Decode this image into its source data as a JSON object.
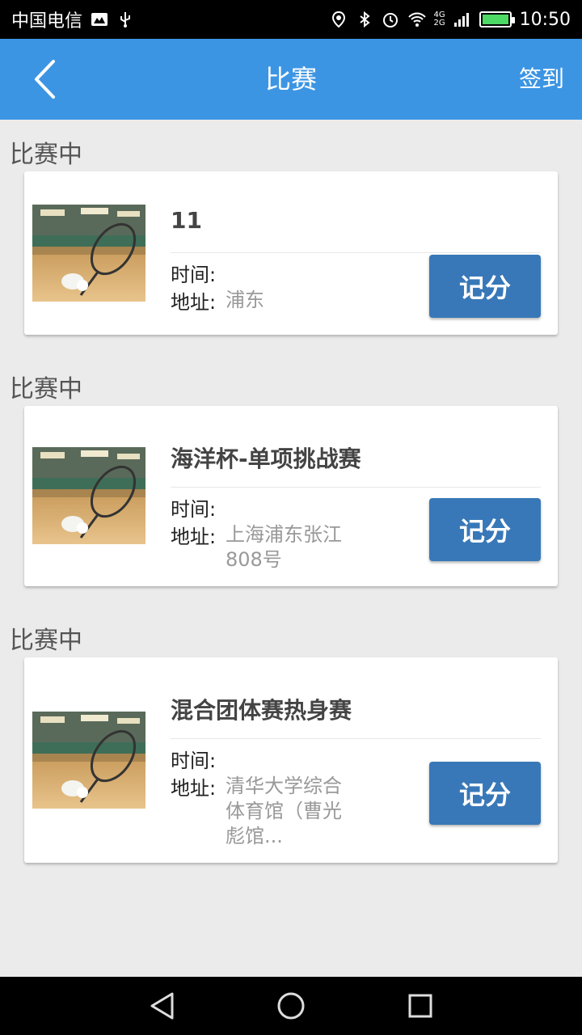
{
  "status_bar": {
    "carrier": "中国电信",
    "signal_top": "4G",
    "signal_bottom": "2G",
    "time": "10:50",
    "battery_level": 1.0
  },
  "header": {
    "title": "比赛",
    "signin_label": "签到"
  },
  "matches": [
    {
      "section_label": "比赛中",
      "title": "11",
      "time_label": "时间:",
      "time_value": "",
      "address_label": "地址:",
      "address_value": "浦东",
      "button_label": "记分"
    },
    {
      "section_label": "比赛中",
      "title": "海洋杯-单项挑战赛",
      "time_label": "时间:",
      "time_value": "",
      "address_label": "地址:",
      "address_value": "上海浦东张江808号",
      "button_label": "记分"
    },
    {
      "section_label": "比赛中",
      "title": "混合团体赛热身赛",
      "time_label": "时间:",
      "time_value": "",
      "address_label": "地址:",
      "address_value": "清华大学综合体育馆（曹光彪馆...",
      "button_label": "记分"
    }
  ],
  "colors": {
    "header_bg": "#3c95e3",
    "button_bg": "#3878b8",
    "page_bg": "#ebebeb"
  },
  "icons": {
    "back": "chevron-left-icon",
    "nav_back": "triangle-back-icon",
    "nav_home": "circle-home-icon",
    "nav_recent": "square-recent-icon"
  }
}
